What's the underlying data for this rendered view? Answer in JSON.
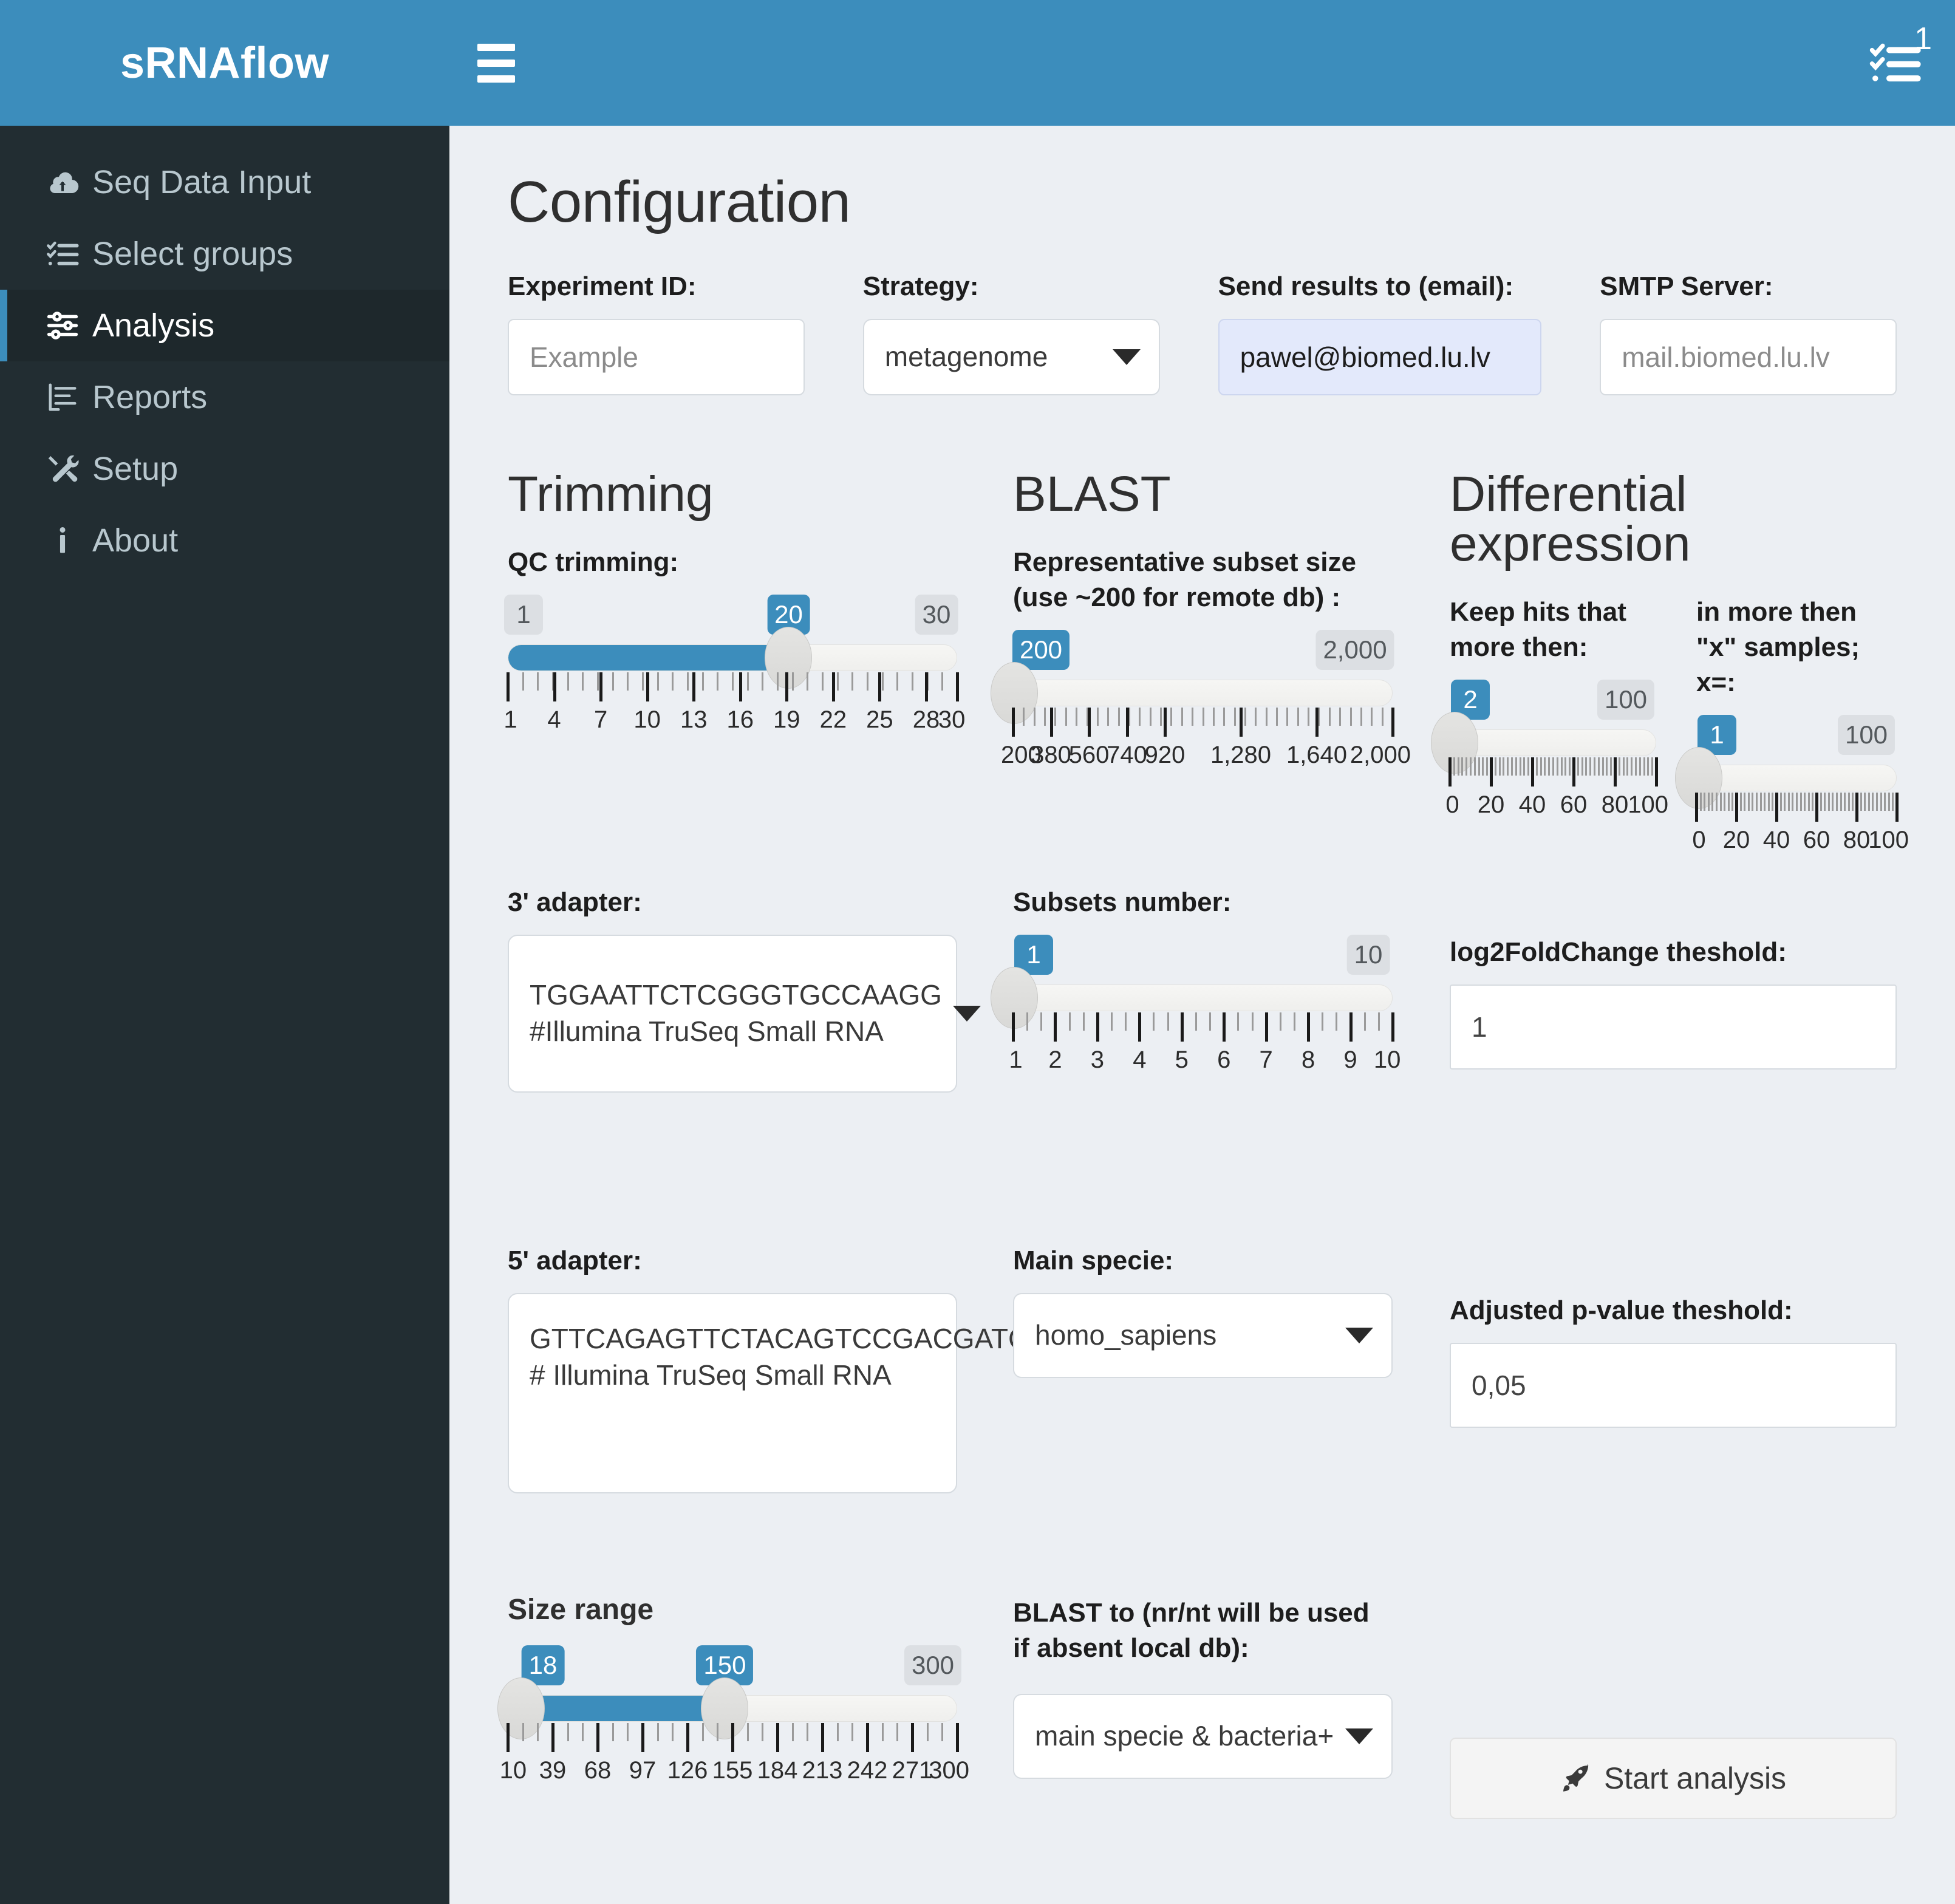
{
  "brand": {
    "title": "sRNAflow"
  },
  "sidebar": {
    "items": [
      {
        "label": "Seq Data Input",
        "icon": "cloud-upload-icon",
        "active": false
      },
      {
        "label": "Select groups",
        "icon": "task-list-icon",
        "active": false
      },
      {
        "label": "Analysis",
        "icon": "sliders-icon",
        "active": true
      },
      {
        "label": "Reports",
        "icon": "bar-chart-icon",
        "active": false
      },
      {
        "label": "Setup",
        "icon": "tools-icon",
        "active": false
      },
      {
        "label": "About",
        "icon": "info-icon",
        "active": false
      }
    ]
  },
  "topbar": {
    "menu_icon": "hamburger-icon",
    "tasks_icon": "task-list-icon",
    "tasks_badge": "1"
  },
  "page": {
    "title": "Configuration"
  },
  "config": {
    "experiment_id": {
      "label": "Experiment ID:",
      "placeholder": "Example",
      "value": ""
    },
    "strategy": {
      "label": "Strategy:",
      "value": "metagenome"
    },
    "email": {
      "label": "Send results to (email):",
      "value": "pawel@biomed.lu.lv"
    },
    "smtp": {
      "label": "SMTP Server:",
      "placeholder": "mail.biomed.lu.lv",
      "value": ""
    }
  },
  "trimming": {
    "title": "Trimming",
    "qc": {
      "label": "QC trimming:",
      "min_bubble": "1",
      "max_bubble": "30",
      "value_bubble": "20",
      "min": 1,
      "max": 30,
      "value": 20,
      "ticklabels": [
        "1",
        "4",
        "7",
        "10",
        "13",
        "16",
        "19",
        "22",
        "25",
        "28",
        "30"
      ],
      "tickvalues": [
        1,
        4,
        7,
        10,
        13,
        16,
        19,
        22,
        25,
        28,
        30
      ]
    },
    "adapter3": {
      "label": "3' adapter:",
      "value": "TGGAATTCTCGGGTGCCAAGG #Illumina TruSeq Small RNA"
    },
    "adapter5": {
      "label": "5' adapter:",
      "value": "GTTCAGAGTTCTACAGTCCGACGATC # Illumina TruSeq Small RNA"
    },
    "size_range": {
      "label": "Size range",
      "min": 10,
      "max": 300,
      "low": 18,
      "high": 150,
      "low_bubble": "18",
      "high_bubble": "150",
      "max_bubble": "300",
      "ticklabels": [
        "10",
        "39",
        "68",
        "97",
        "126",
        "155",
        "184",
        "213",
        "242",
        "271",
        "300"
      ],
      "tickvalues": [
        10,
        39,
        68,
        97,
        126,
        155,
        184,
        213,
        242,
        271,
        300
      ]
    }
  },
  "blast": {
    "title": "BLAST",
    "subset_size": {
      "label": "Representative subset size (use ~200 for remote db) :",
      "min": 200,
      "max": 2000,
      "value": 200,
      "value_bubble": "200",
      "max_bubble": "2,000",
      "ticklabels": [
        "200",
        "380",
        "560",
        "740",
        "920",
        "1,280",
        "1,640",
        "2,000"
      ],
      "tickvalues": [
        200,
        380,
        560,
        740,
        920,
        1280,
        1640,
        2000
      ]
    },
    "subsets_number": {
      "label": "Subsets number:",
      "min": 1,
      "max": 10,
      "value": 1,
      "value_bubble": "1",
      "max_bubble": "10",
      "ticklabels": [
        "1",
        "2",
        "3",
        "4",
        "5",
        "6",
        "7",
        "8",
        "9",
        "10"
      ],
      "tickvalues": [
        1,
        2,
        3,
        4,
        5,
        6,
        7,
        8,
        9,
        10
      ]
    },
    "main_specie": {
      "label": "Main specie:",
      "value": "homo_sapiens"
    },
    "blast_to": {
      "label": "BLAST to (nr/nt will be used if absent local db):",
      "value": "main specie & bacteria+"
    }
  },
  "differential": {
    "title": "Differential expression",
    "keep_hits": {
      "label": "Keep hits that more then:",
      "min": 0,
      "max": 100,
      "value": 2,
      "value_bubble": "2",
      "max_bubble": "100",
      "ticklabels": [
        "0",
        "20",
        "40",
        "60",
        "80",
        "100"
      ],
      "tickvalues": [
        0,
        20,
        40,
        60,
        80,
        100
      ]
    },
    "in_samples": {
      "label": "in more then \"x\" samples; x=:",
      "min": 0,
      "max": 100,
      "value": 1,
      "value_bubble": "1",
      "max_bubble": "100",
      "ticklabels": [
        "0",
        "20",
        "40",
        "60",
        "80",
        "100"
      ],
      "tickvalues": [
        0,
        20,
        40,
        60,
        80,
        100
      ]
    },
    "log2fc": {
      "label": "log2FoldChange theshold:",
      "value": "1"
    },
    "padj": {
      "label": "Adjusted p-value theshold:",
      "value": "0,05"
    },
    "start_button": {
      "label": "Start analysis",
      "icon": "rocket-icon"
    }
  },
  "colors": {
    "brand_blue": "#3c8dbc",
    "sidebar_dark": "#222d32",
    "sidebar_active": "#1e282c",
    "content_bg": "#eceff3",
    "autofill_blue": "#e3e9fb"
  }
}
